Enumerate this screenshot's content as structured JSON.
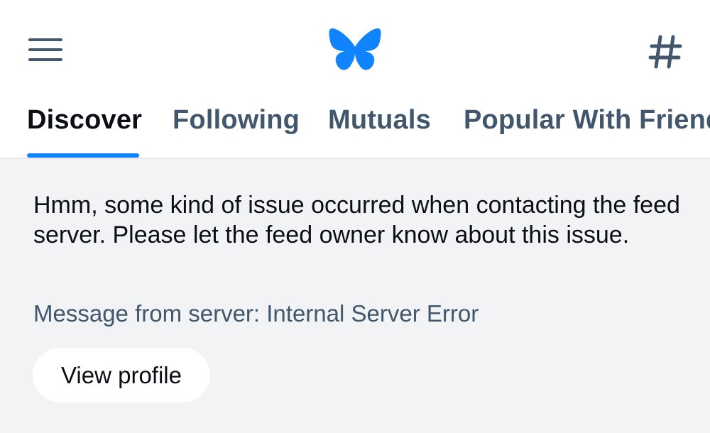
{
  "header": {
    "menu_icon": "menu-icon",
    "logo_icon": "butterfly-logo-icon",
    "hashtag_icon": "hashtag-icon",
    "logo_color": "#1083fe"
  },
  "tabs": [
    {
      "label": "Discover",
      "active": true
    },
    {
      "label": "Following",
      "active": false
    },
    {
      "label": "Mutuals",
      "active": false
    },
    {
      "label": "Popular With Friends",
      "active": false
    }
  ],
  "feed_error": {
    "message": "Hmm, some kind of issue occurred when contacting the feed server. Please let the feed owner know about this issue.",
    "server_message": "Message from server: Internal Server Error",
    "view_profile_label": "View profile"
  },
  "colors": {
    "accent": "#1083fe",
    "text_primary": "#0b0f14",
    "text_secondary": "#42576c",
    "content_bg": "#f1f3f5"
  }
}
